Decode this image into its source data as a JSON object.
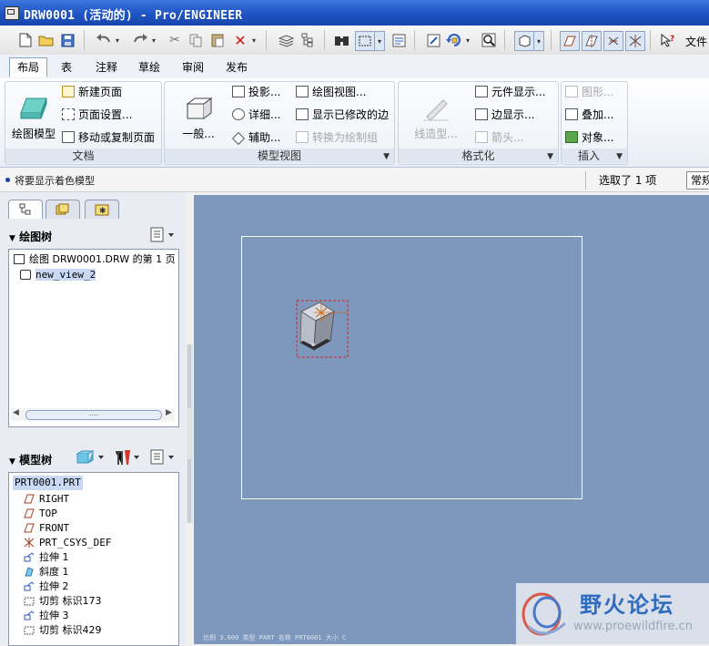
{
  "window": {
    "title": "DRW0001 (活动的) - Pro/ENGINEER"
  },
  "toolbar": {
    "file_menu": "文件",
    "icons": [
      "new-file-icon",
      "open-folder-icon",
      "save-icon",
      "undo-icon",
      "redo-icon",
      "cut-icon",
      "copy-icon",
      "paste-icon",
      "delete-icon",
      "layers-icon",
      "model-tree-icon",
      "find-icon",
      "selection-box-icon",
      "properties-icon",
      "refresh-icon",
      "regenerate-icon",
      "zoom-icon",
      "display-style-icon",
      "datum-planes-icon",
      "datum-axes-icon",
      "datum-points-icon",
      "datum-csys-icon",
      "help-icon"
    ]
  },
  "ribbon": {
    "tabs": [
      "布局",
      "表",
      "注释",
      "草绘",
      "审阅",
      "发布"
    ],
    "active_tab": "布局",
    "groups": {
      "document": {
        "title": "文档",
        "big_button": "绘图模型",
        "items": [
          "新建页面",
          "页面设置...",
          "移动或复制页面"
        ]
      },
      "model_views": {
        "title": "模型视图",
        "big_button": "一般...",
        "col1": [
          "投影...",
          "详细...",
          "辅助..."
        ],
        "col2": [
          "绘图视图...",
          "显示已修改的边",
          "转换为绘制组"
        ]
      },
      "format": {
        "title": "格式化",
        "big_button": "线造型...",
        "items": [
          "元件显示...",
          "边显示...",
          "箭头..."
        ]
      },
      "insert": {
        "title": "插入",
        "items": [
          "图形...",
          "叠加...",
          "对象..."
        ]
      }
    }
  },
  "message_bar": {
    "message": "将要显示着色模型",
    "selection": "选取了 1 项",
    "filter": "常规"
  },
  "left_panel": {
    "drawing_tree": {
      "title": "绘图树",
      "root": "绘图 DRW0001.DRW 的第 1 页",
      "children": [
        "new_view_2"
      ]
    },
    "scroll_grip": "....",
    "model_tree": {
      "title": "模型树",
      "root": "PRT0001.PRT",
      "items": [
        {
          "icon": "datum-plane-icon",
          "label": "RIGHT"
        },
        {
          "icon": "datum-plane-icon",
          "label": "TOP"
        },
        {
          "icon": "datum-plane-icon",
          "label": "FRONT"
        },
        {
          "icon": "csys-icon",
          "label": "PRT_CSYS_DEF"
        },
        {
          "icon": "extrude-icon",
          "label": "拉伸 1"
        },
        {
          "icon": "draft-icon",
          "label": "斜度 1"
        },
        {
          "icon": "extrude-icon",
          "label": "拉伸 2"
        },
        {
          "icon": "cut-feature-icon",
          "label": "切剪 标识173"
        },
        {
          "icon": "extrude-icon",
          "label": "拉伸 3"
        },
        {
          "icon": "cut-feature-icon",
          "label": "切剪 标识429"
        }
      ]
    }
  },
  "canvas": {
    "status_text": "比例 3.000   类型 PART   名称 PRT0001   大小 C"
  },
  "watermark": {
    "title": "野火论坛",
    "url": "www.proewildfire.cn"
  },
  "colors": {
    "titlebar": "#1e53c4",
    "canvas_bg": "#7e97bd",
    "selection_box": "#d32020",
    "watermark_text": "#2f6cc0"
  }
}
